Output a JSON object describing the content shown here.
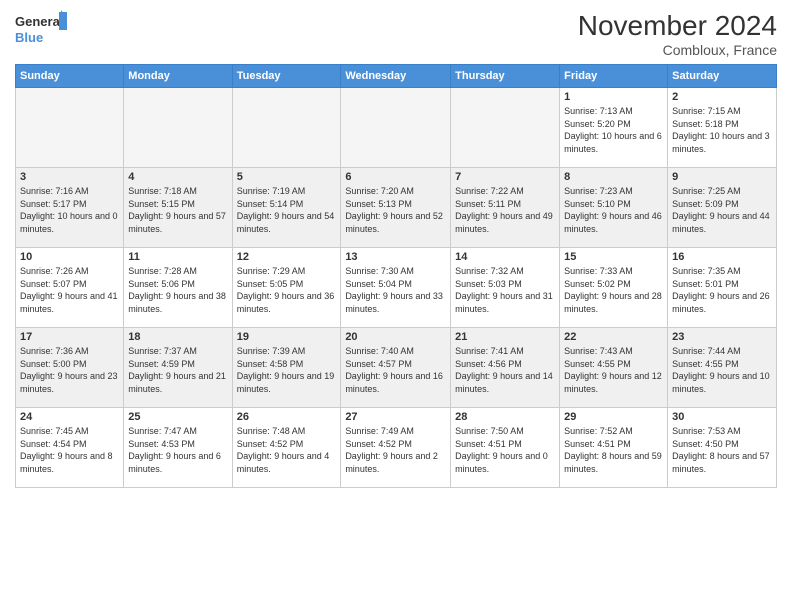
{
  "logo": {
    "line1": "General",
    "line2": "Blue"
  },
  "title": "November 2024",
  "location": "Combloux, France",
  "weekdays": [
    "Sunday",
    "Monday",
    "Tuesday",
    "Wednesday",
    "Thursday",
    "Friday",
    "Saturday"
  ],
  "weeks": [
    [
      {
        "day": "",
        "empty": true
      },
      {
        "day": "",
        "empty": true
      },
      {
        "day": "",
        "empty": true
      },
      {
        "day": "",
        "empty": true
      },
      {
        "day": "",
        "empty": true
      },
      {
        "day": "1",
        "sunrise": "7:13 AM",
        "sunset": "5:20 PM",
        "daylight": "10 hours and 6 minutes."
      },
      {
        "day": "2",
        "sunrise": "7:15 AM",
        "sunset": "5:18 PM",
        "daylight": "10 hours and 3 minutes."
      }
    ],
    [
      {
        "day": "3",
        "sunrise": "7:16 AM",
        "sunset": "5:17 PM",
        "daylight": "10 hours and 0 minutes."
      },
      {
        "day": "4",
        "sunrise": "7:18 AM",
        "sunset": "5:15 PM",
        "daylight": "9 hours and 57 minutes."
      },
      {
        "day": "5",
        "sunrise": "7:19 AM",
        "sunset": "5:14 PM",
        "daylight": "9 hours and 54 minutes."
      },
      {
        "day": "6",
        "sunrise": "7:20 AM",
        "sunset": "5:13 PM",
        "daylight": "9 hours and 52 minutes."
      },
      {
        "day": "7",
        "sunrise": "7:22 AM",
        "sunset": "5:11 PM",
        "daylight": "9 hours and 49 minutes."
      },
      {
        "day": "8",
        "sunrise": "7:23 AM",
        "sunset": "5:10 PM",
        "daylight": "9 hours and 46 minutes."
      },
      {
        "day": "9",
        "sunrise": "7:25 AM",
        "sunset": "5:09 PM",
        "daylight": "9 hours and 44 minutes."
      }
    ],
    [
      {
        "day": "10",
        "sunrise": "7:26 AM",
        "sunset": "5:07 PM",
        "daylight": "9 hours and 41 minutes."
      },
      {
        "day": "11",
        "sunrise": "7:28 AM",
        "sunset": "5:06 PM",
        "daylight": "9 hours and 38 minutes."
      },
      {
        "day": "12",
        "sunrise": "7:29 AM",
        "sunset": "5:05 PM",
        "daylight": "9 hours and 36 minutes."
      },
      {
        "day": "13",
        "sunrise": "7:30 AM",
        "sunset": "5:04 PM",
        "daylight": "9 hours and 33 minutes."
      },
      {
        "day": "14",
        "sunrise": "7:32 AM",
        "sunset": "5:03 PM",
        "daylight": "9 hours and 31 minutes."
      },
      {
        "day": "15",
        "sunrise": "7:33 AM",
        "sunset": "5:02 PM",
        "daylight": "9 hours and 28 minutes."
      },
      {
        "day": "16",
        "sunrise": "7:35 AM",
        "sunset": "5:01 PM",
        "daylight": "9 hours and 26 minutes."
      }
    ],
    [
      {
        "day": "17",
        "sunrise": "7:36 AM",
        "sunset": "5:00 PM",
        "daylight": "9 hours and 23 minutes."
      },
      {
        "day": "18",
        "sunrise": "7:37 AM",
        "sunset": "4:59 PM",
        "daylight": "9 hours and 21 minutes."
      },
      {
        "day": "19",
        "sunrise": "7:39 AM",
        "sunset": "4:58 PM",
        "daylight": "9 hours and 19 minutes."
      },
      {
        "day": "20",
        "sunrise": "7:40 AM",
        "sunset": "4:57 PM",
        "daylight": "9 hours and 16 minutes."
      },
      {
        "day": "21",
        "sunrise": "7:41 AM",
        "sunset": "4:56 PM",
        "daylight": "9 hours and 14 minutes."
      },
      {
        "day": "22",
        "sunrise": "7:43 AM",
        "sunset": "4:55 PM",
        "daylight": "9 hours and 12 minutes."
      },
      {
        "day": "23",
        "sunrise": "7:44 AM",
        "sunset": "4:55 PM",
        "daylight": "9 hours and 10 minutes."
      }
    ],
    [
      {
        "day": "24",
        "sunrise": "7:45 AM",
        "sunset": "4:54 PM",
        "daylight": "9 hours and 8 minutes."
      },
      {
        "day": "25",
        "sunrise": "7:47 AM",
        "sunset": "4:53 PM",
        "daylight": "9 hours and 6 minutes."
      },
      {
        "day": "26",
        "sunrise": "7:48 AM",
        "sunset": "4:52 PM",
        "daylight": "9 hours and 4 minutes."
      },
      {
        "day": "27",
        "sunrise": "7:49 AM",
        "sunset": "4:52 PM",
        "daylight": "9 hours and 2 minutes."
      },
      {
        "day": "28",
        "sunrise": "7:50 AM",
        "sunset": "4:51 PM",
        "daylight": "9 hours and 0 minutes."
      },
      {
        "day": "29",
        "sunrise": "7:52 AM",
        "sunset": "4:51 PM",
        "daylight": "8 hours and 59 minutes."
      },
      {
        "day": "30",
        "sunrise": "7:53 AM",
        "sunset": "4:50 PM",
        "daylight": "8 hours and 57 minutes."
      }
    ]
  ]
}
